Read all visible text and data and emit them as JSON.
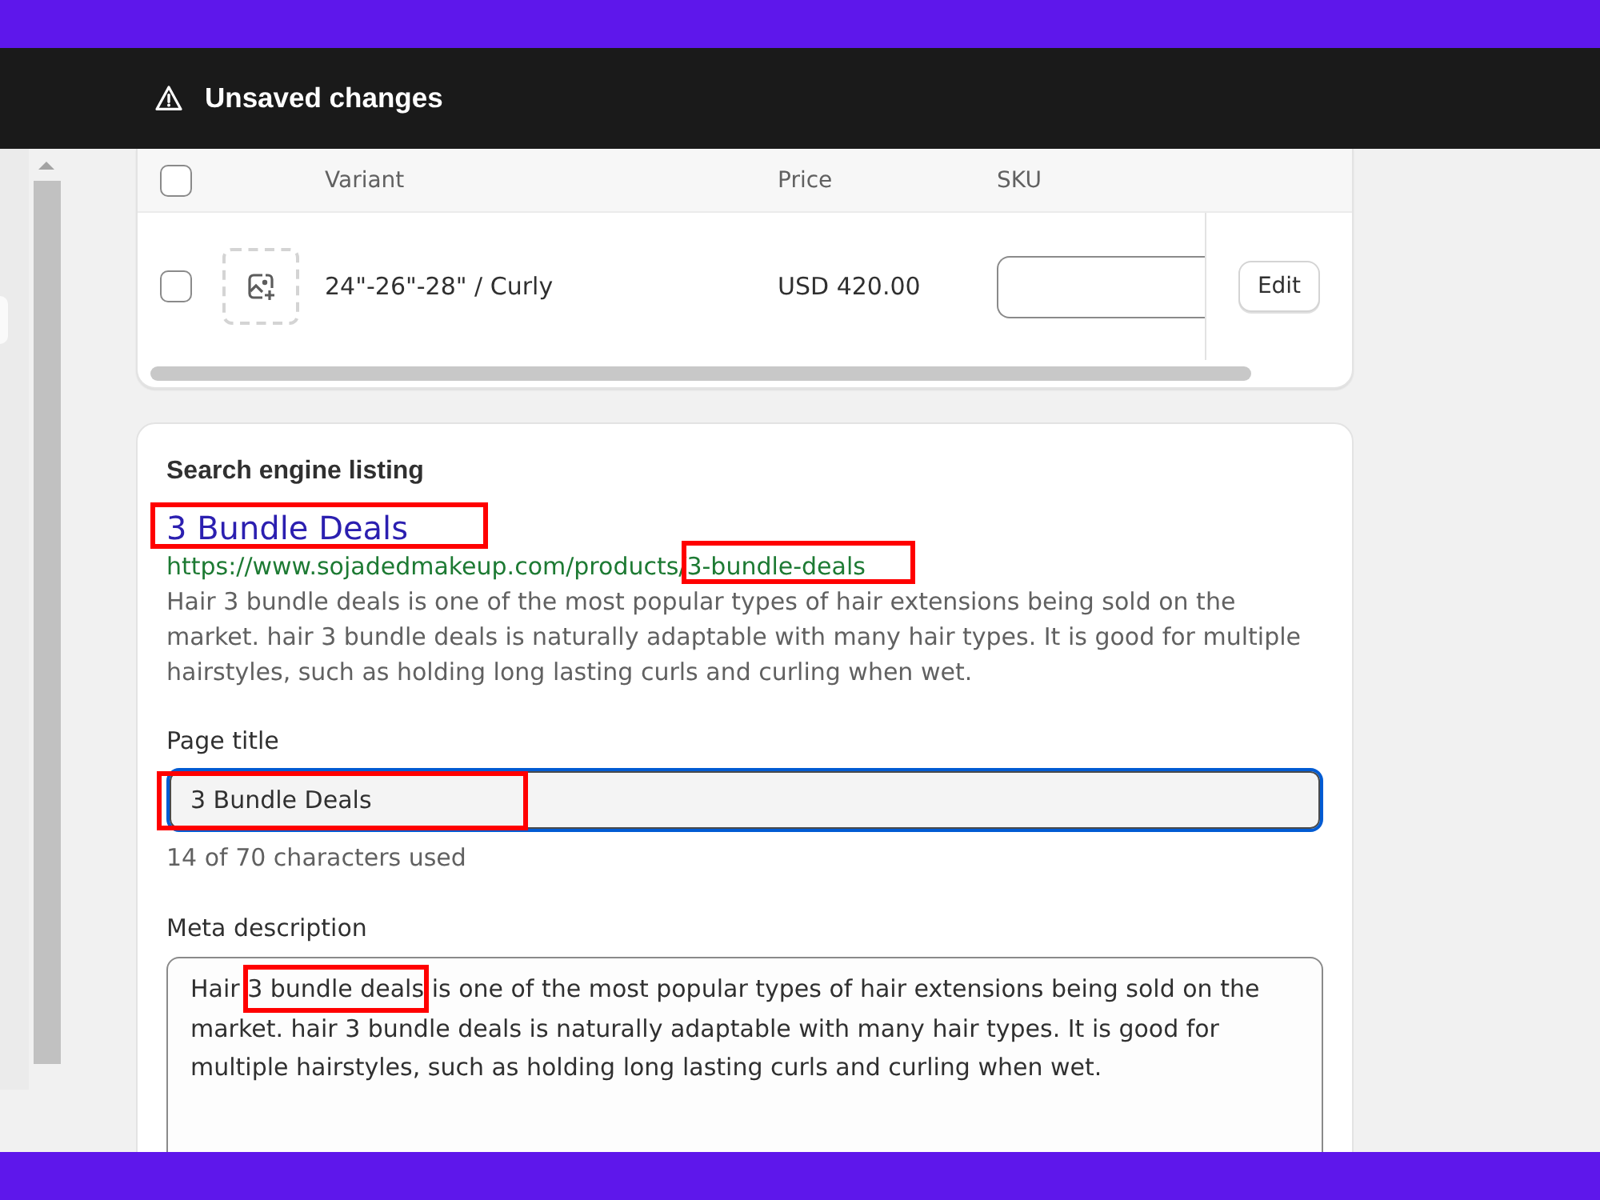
{
  "banner": {
    "title": "Unsaved changes"
  },
  "variants_table": {
    "select_all": {
      "checked": false
    },
    "columns": [
      "Variant",
      "Price",
      "SKU"
    ],
    "rows": [
      {
        "checked": false,
        "variant": "24\"-26\"-28\" / Curly",
        "price": "USD 420.00",
        "action": "Edit"
      }
    ]
  },
  "seo": {
    "heading": "Search engine listing",
    "preview": {
      "title": "3 Bundle Deals",
      "title_highlighted": true,
      "url_base": "https://www.sojadedmakeup.com/products/",
      "url_slug": "3-bundle-deals",
      "slug_highlighted": true,
      "description": "Hair 3 bundle deals is one of the most popular types of hair extensions being sold on the market. hair 3 bundle deals is naturally adaptable with many hair types. It is good for multiple hairstyles, such as holding long lasting curls and curling when wet."
    },
    "page_title": {
      "label": "Page title",
      "value": "3 Bundle Deals",
      "focused": true,
      "highlighted": true,
      "hint": "14 of 70 characters used"
    },
    "meta_description": {
      "label": "Meta description",
      "segments": [
        {
          "text": "Hair ",
          "highlighted": false
        },
        {
          "text": "3 bundle deals",
          "highlighted": true
        },
        {
          "text": " is one of the most popular types of hair extensions being sold on the market. hair 3 bundle deals is naturally adaptable with many hair types. It is good for multiple hairstyles, such as holding long lasting curls and curling when wet.",
          "highlighted": false
        }
      ]
    }
  }
}
